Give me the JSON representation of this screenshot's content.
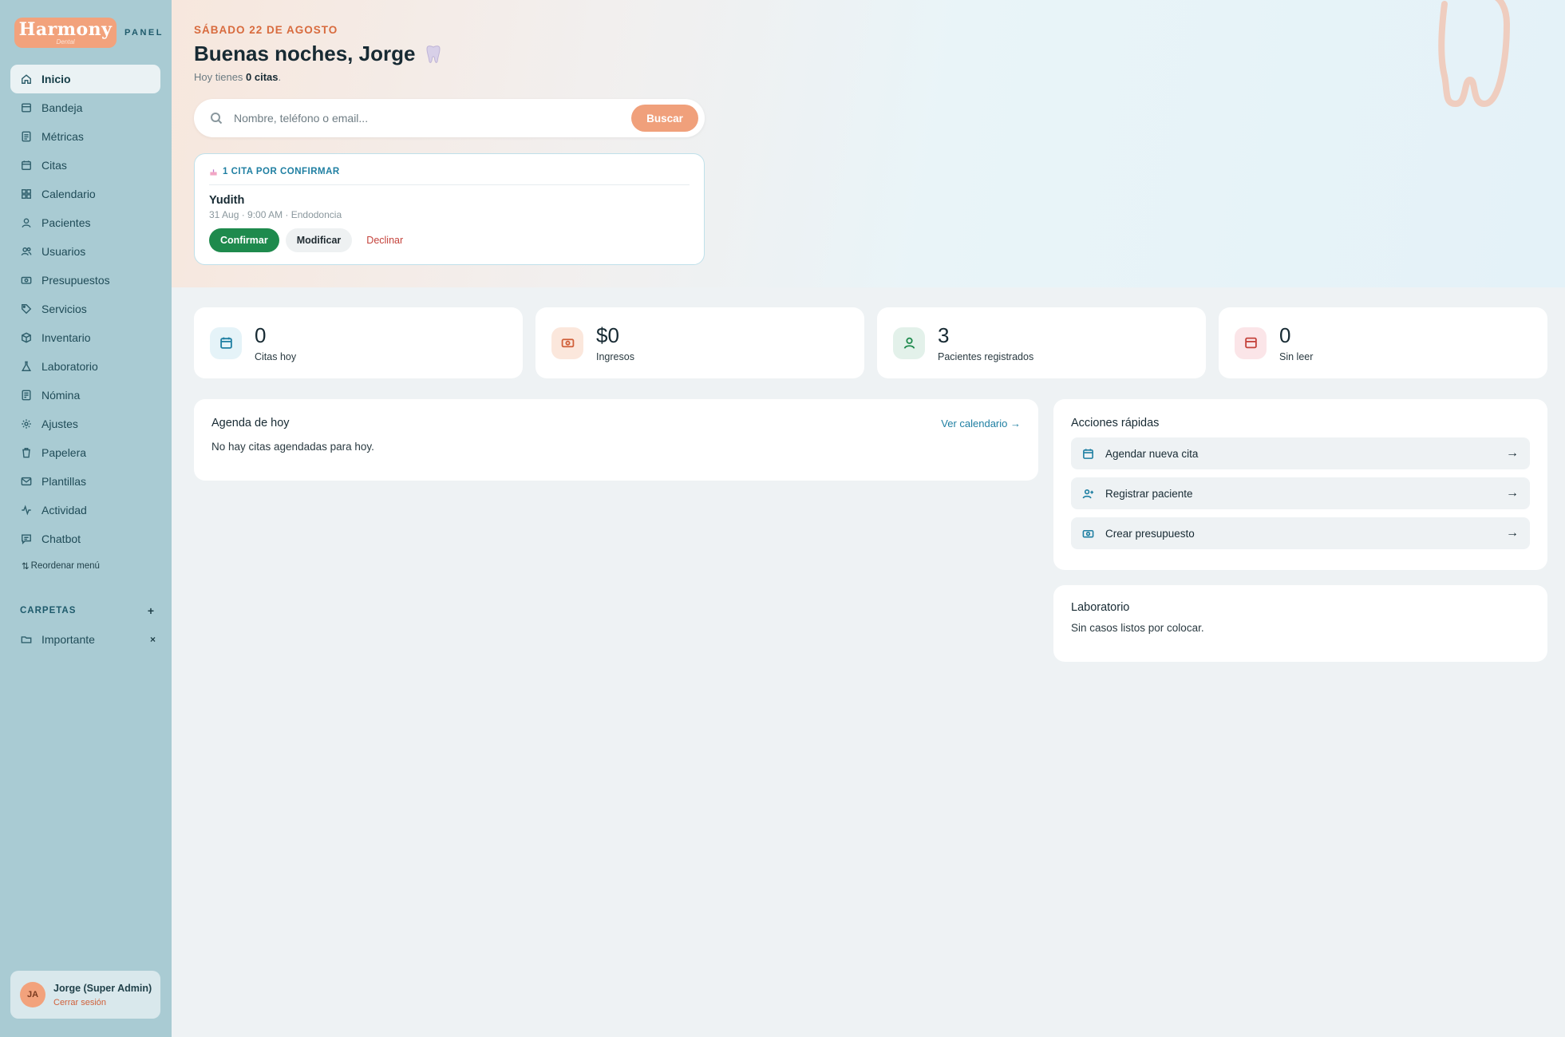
{
  "brand": {
    "logo_main": "Harmony",
    "logo_sub": "Dental",
    "panel_label": "PANEL"
  },
  "nav": {
    "items": [
      {
        "label": "Inicio",
        "icon": "home-icon"
      },
      {
        "label": "Bandeja",
        "icon": "inbox-icon"
      },
      {
        "label": "Métricas",
        "icon": "metrics-icon"
      },
      {
        "label": "Citas",
        "icon": "calendar-icon"
      },
      {
        "label": "Calendario",
        "icon": "grid-icon"
      },
      {
        "label": "Pacientes",
        "icon": "user-icon"
      },
      {
        "label": "Usuarios",
        "icon": "users-icon"
      },
      {
        "label": "Presupuestos",
        "icon": "money-icon"
      },
      {
        "label": "Servicios",
        "icon": "tag-icon"
      },
      {
        "label": "Inventario",
        "icon": "box-icon"
      },
      {
        "label": "Laboratorio",
        "icon": "flask-icon"
      },
      {
        "label": "Nómina",
        "icon": "payroll-icon"
      },
      {
        "label": "Ajustes",
        "icon": "gear-icon"
      },
      {
        "label": "Papelera",
        "icon": "trash-icon"
      },
      {
        "label": "Plantillas",
        "icon": "mail-icon"
      },
      {
        "label": "Actividad",
        "icon": "activity-icon"
      },
      {
        "label": "Chatbot",
        "icon": "chat-icon"
      }
    ],
    "active_index": 0,
    "reorder_label": "Reordenar menú"
  },
  "folders": {
    "title": "CARPETAS",
    "add_label": "+",
    "items": [
      {
        "label": "Importante",
        "remove_label": "×"
      }
    ]
  },
  "user": {
    "initials": "JA",
    "name": "Jorge (Super Admin)",
    "logout_label": "Cerrar sesión"
  },
  "hero": {
    "date": "SÁBADO 22 DE AGOSTO",
    "greeting": "Buenas noches, Jorge",
    "sub_prefix": "Hoy tienes",
    "sub_count": "0 citas",
    "sub_suffix": "."
  },
  "search": {
    "placeholder": "Nombre, teléfono o email...",
    "value": "",
    "button_label": "Buscar"
  },
  "pending": {
    "header": "1 CITA POR CONFIRMAR",
    "patient": "Yudith",
    "meta": "31 Aug · 9:00 AM · Endodoncia",
    "confirm_label": "Confirmar",
    "modify_label": "Modificar",
    "decline_label": "Declinar"
  },
  "stats": [
    {
      "value": "0",
      "label": "Citas hoy",
      "icon": "calendar-icon",
      "bg": "#e5f3f8",
      "color": "#1f7fa2"
    },
    {
      "value": "$0",
      "label": "Ingresos",
      "icon": "money-icon",
      "bg": "#fbe7dc",
      "color": "#d0603a"
    },
    {
      "value": "3",
      "label": "Pacientes registrados",
      "icon": "user-icon",
      "bg": "#e3f1ea",
      "color": "#1e8a4d"
    },
    {
      "value": "0",
      "label": "Sin leer",
      "icon": "inbox-icon",
      "bg": "#fbe5e8",
      "color": "#c4423b"
    }
  ],
  "agenda": {
    "title": "Agenda de hoy",
    "link": "Ver calendario →",
    "empty": "No hay citas agendadas para hoy."
  },
  "quick_actions": {
    "title": "Acciones rápidas",
    "items": [
      {
        "label": "Agendar nueva cita",
        "icon": "calendar-icon"
      },
      {
        "label": "Registrar paciente",
        "icon": "add-user-icon"
      },
      {
        "label": "Crear presupuesto",
        "icon": "money-icon"
      }
    ],
    "arrow": "→"
  },
  "lab": {
    "title": "Laboratorio",
    "text": "Sin casos listos por colocar."
  },
  "colors": {
    "sidebar": "#a9cbd3",
    "accent": "#f0a07b",
    "primary": "#1f7fa2",
    "success": "#1e8a4d",
    "danger": "#c4423b"
  }
}
